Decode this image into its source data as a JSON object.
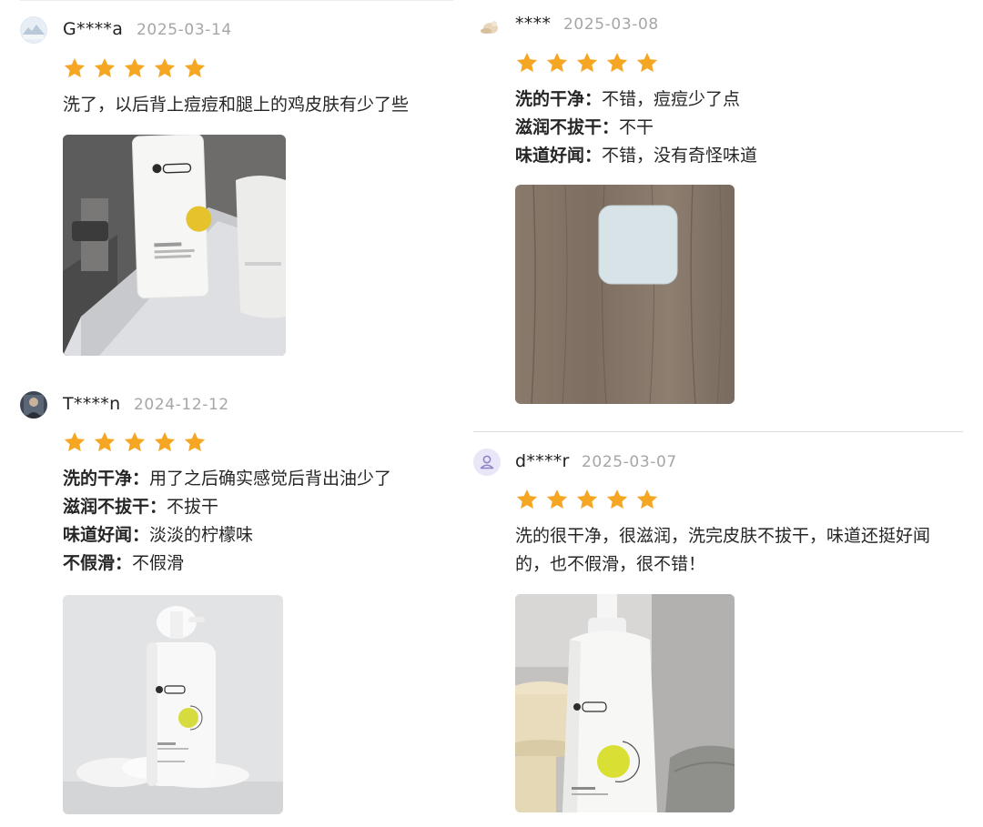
{
  "reviews": [
    {
      "user": "G****a",
      "date": "2025-03-14",
      "rating": 5,
      "text": "洗了，以后背上痘痘和腿上的鸡皮肤有少了些"
    },
    {
      "user": "T****n",
      "date": "2024-12-12",
      "rating": 5,
      "attrs": [
        {
          "label": "洗的干净：",
          "value": "用了之后确实感觉后背出油少了"
        },
        {
          "label": "滋润不拔干：",
          "value": "不拔干"
        },
        {
          "label": "味道好闻：",
          "value": "淡淡的柠檬味"
        },
        {
          "label": "不假滑：",
          "value": "不假滑"
        }
      ]
    },
    {
      "user": "****",
      "date": "2025-03-08",
      "rating": 5,
      "attrs": [
        {
          "label": "洗的干净：",
          "value": "不错，痘痘少了点"
        },
        {
          "label": "滋润不拔干：",
          "value": "不干"
        },
        {
          "label": "味道好闻：",
          "value": "不错，没有奇怪味道"
        }
      ]
    },
    {
      "user": "d****r",
      "date": "2025-03-07",
      "rating": 5,
      "text_lines": [
        "洗的很干净，很滋润，洗完皮肤不拔干，味道还挺好闻",
        "的，也不假滑，很不错！"
      ]
    }
  ],
  "icons": {
    "star": "star-icon",
    "default_avatar": "user-icon"
  },
  "colors": {
    "star": "#f5a623",
    "date": "#a6a6a6",
    "default_avatar_bg": "#e8e6f7",
    "default_avatar_fg": "#8a80c8"
  }
}
